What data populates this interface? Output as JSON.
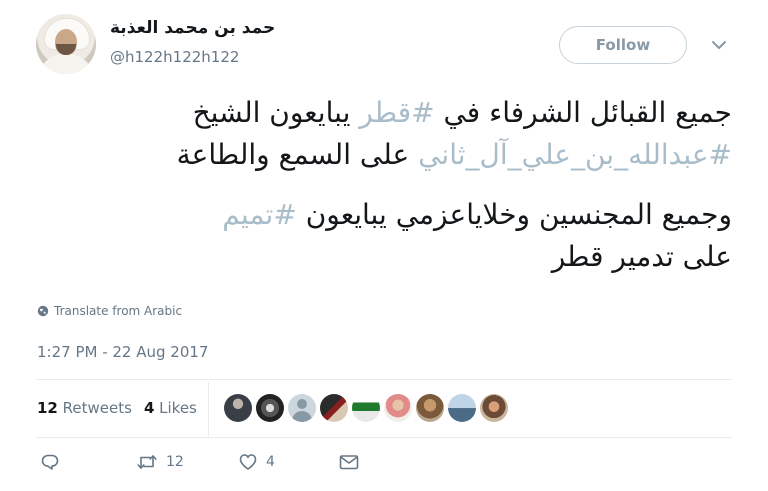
{
  "user": {
    "display_name": "حمد بن محمد العذبة",
    "screen_name": "@h122h122h122"
  },
  "follow_label": "Follow",
  "tweet": {
    "line1_text": "جميع القبائل الشرفاء في ",
    "line1_hashtag": "#قطر",
    "line1_end": " يبايعون الشيخ",
    "line2_hashtag": "#عبدالله_بن_علي_آل_ثاني",
    "line2_end": " على السمع والطاعة",
    "line3_text": "وجميع المجنسين وخلاياعزمي يبايعون ",
    "line3_hashtag": "#تميم",
    "line4_text": "على تدمير قطر"
  },
  "translate_label": "Translate from Arabic",
  "timestamp": "1:27 PM - 22 Aug 2017",
  "stats": {
    "retweets_count": "12",
    "retweets_label": "Retweets",
    "likes_count": "4",
    "likes_label": "Likes"
  },
  "actions": {
    "retweet_count": "12",
    "like_count": "4"
  },
  "colors": {
    "hashtag": "#a9bcc9",
    "secondary_text": "#657786",
    "divider": "#e6ecf0"
  }
}
